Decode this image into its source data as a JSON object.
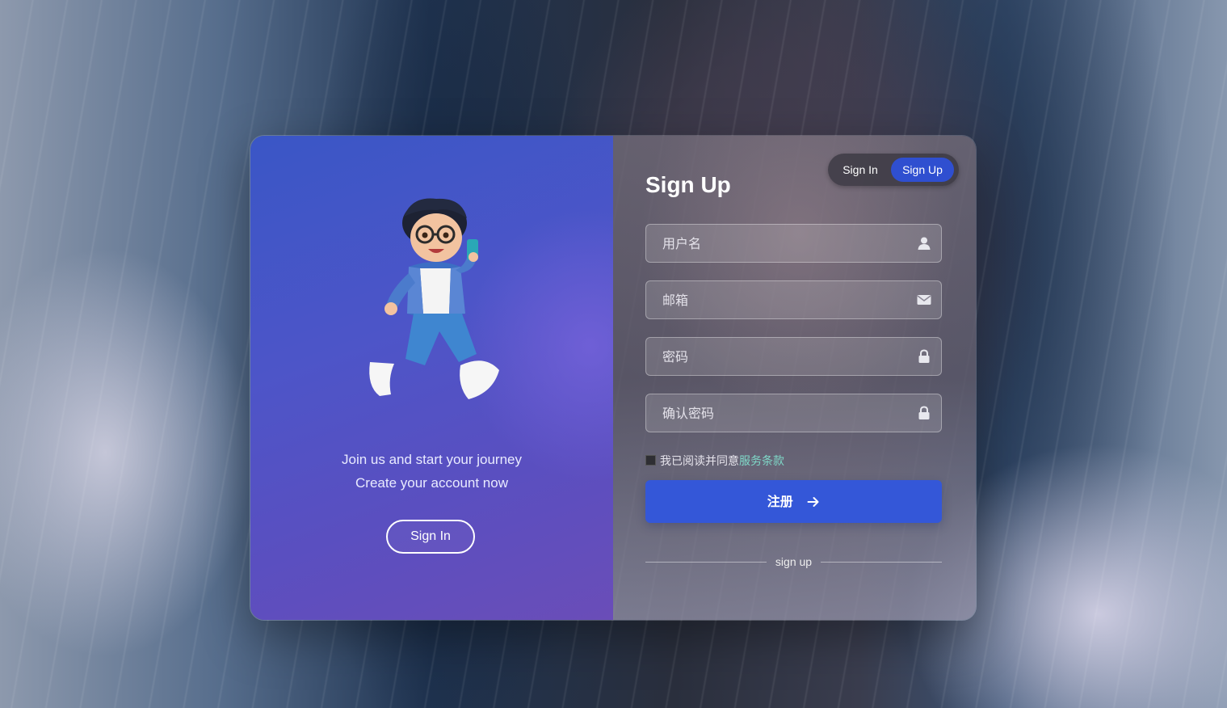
{
  "welcome": {
    "line1": "Join us and start your journey",
    "line2": "Create your account now",
    "signin_button": "Sign In"
  },
  "toggle": {
    "signin_label": "Sign In",
    "signup_label": "Sign Up",
    "active": "Sign Up"
  },
  "form": {
    "title": "Sign Up",
    "username_placeholder": "用户名",
    "email_placeholder": "邮箱",
    "password_placeholder": "密码",
    "confirm_placeholder": "确认密码",
    "agree_text": "我已阅读并同意",
    "agree_link": "服务条款",
    "submit_label": "注册",
    "divider_text": "sign up"
  },
  "icons": {
    "username": "user-icon",
    "email": "envelope-icon",
    "password": "lock-icon",
    "confirm": "lock-icon",
    "submit": "arrow-right-icon"
  },
  "colors": {
    "accent": "#3457d8",
    "toggle_active": "#2f4fd0",
    "link": "#7fd8c8"
  }
}
